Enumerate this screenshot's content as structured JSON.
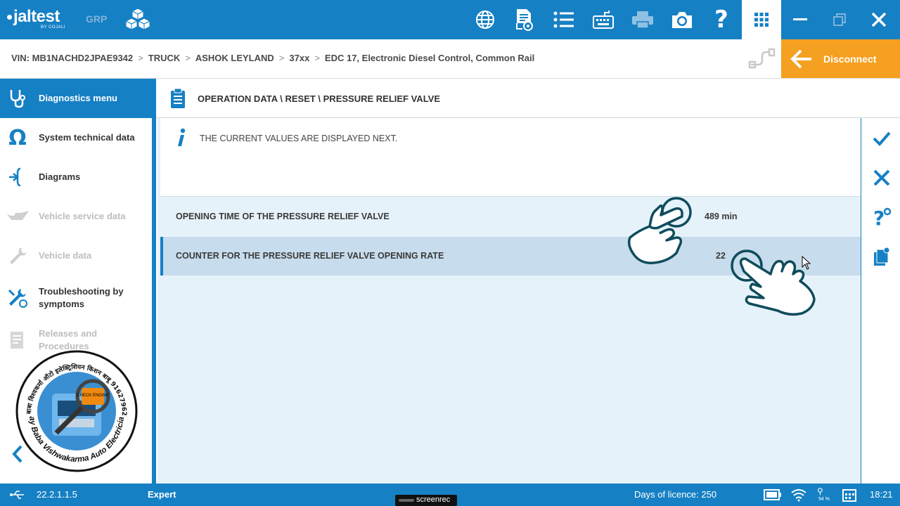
{
  "topbar": {
    "logo_text": "jaltest",
    "logo_sub": "BY COJALI",
    "grp_label": "GRP",
    "tools": [
      "globe-icon",
      "document-view-icon",
      "list-icon",
      "keyboard-icon",
      "printer-icon",
      "camera-icon",
      "help-icon"
    ],
    "accent": "#1680c4"
  },
  "breadcrumb": {
    "vin": "VIN: MB1NACHD2JPAE9342",
    "items": [
      "TRUCK",
      "ASHOK LEYLAND",
      "37xx",
      "EDC 17, Electronic Diesel Control, Common Rail"
    ]
  },
  "disconnect": {
    "label": "Disconnect",
    "color": "#f5a020"
  },
  "sidebar": {
    "items": [
      {
        "label": "Diagnostics menu",
        "icon": "stethoscope-icon",
        "state": "active"
      },
      {
        "label": "System technical data",
        "icon": "omega-icon",
        "state": "normal"
      },
      {
        "label": "Diagrams",
        "icon": "diagram-icon",
        "state": "normal"
      },
      {
        "label": "Vehicle service data",
        "icon": "oil-can-icon",
        "state": "disabled"
      },
      {
        "label": "Vehicle data",
        "icon": "wrench-icon",
        "state": "disabled"
      },
      {
        "label": "Troubleshooting by symptoms",
        "icon": "troubleshooting-icon",
        "state": "normal"
      },
      {
        "label": "Releases and Procedures",
        "icon": "releases-icon",
        "state": "disabled"
      }
    ]
  },
  "main": {
    "title": "OPERATION DATA \\ RESET \\ PRESSURE RELIEF VALVE",
    "info_message": "THE CURRENT VALUES ARE DISPLAYED NEXT.",
    "rows": [
      {
        "label": "OPENING TIME OF THE PRESSURE RELIEF VALVE",
        "value": "489 min",
        "selected": false
      },
      {
        "label": "COUNTER FOR THE PRESSURE RELIEF VALVE OPENING RATE",
        "value": "22",
        "selected": true
      }
    ]
  },
  "rightbar": {
    "actions": [
      "confirm-check-icon",
      "cancel-x-icon",
      "help-question-icon",
      "clipboard-icon"
    ]
  },
  "stamp": {
    "top_text": "जय बाबा विश्वकर्मा ऑटो इलेक्ट्रिशियन किशन बाबू 9162796279",
    "bottom_text": "Jay Baba Vishwakarma Auto Electrician",
    "badge": "CHECK ENGINE"
  },
  "bottombar": {
    "version": "22.2.1.1.5",
    "mode": "Expert",
    "licence": "Days of licence: 250",
    "wifi_pct": "94 %",
    "time": "18:21"
  },
  "watermark": {
    "text": "screenrec"
  }
}
